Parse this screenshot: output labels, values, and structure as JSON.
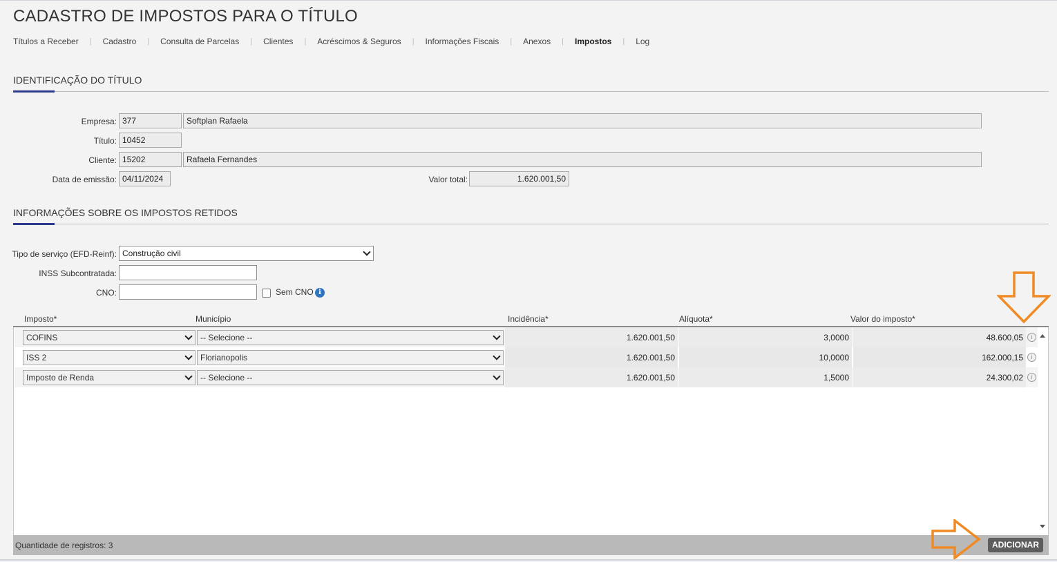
{
  "page": {
    "title": "CADASTRO DE IMPOSTOS PARA O TÍTULO"
  },
  "tabs": [
    {
      "label": "Títulos a Receber",
      "active": false
    },
    {
      "label": "Cadastro",
      "active": false
    },
    {
      "label": "Consulta de Parcelas",
      "active": false
    },
    {
      "label": "Clientes",
      "active": false
    },
    {
      "label": "Acréscimos & Seguros",
      "active": false
    },
    {
      "label": "Informações Fiscais",
      "active": false
    },
    {
      "label": "Anexos",
      "active": false
    },
    {
      "label": "Impostos",
      "active": true
    },
    {
      "label": "Log",
      "active": false
    }
  ],
  "identificacao": {
    "section_title": "IDENTIFICAÇÃO DO TÍTULO",
    "empresa_label": "Empresa:",
    "empresa_codigo": "377",
    "empresa_nome": "Softplan Rafaela",
    "titulo_label": "Título:",
    "titulo_valor": "10452",
    "cliente_label": "Cliente:",
    "cliente_codigo": "15202",
    "cliente_nome": "Rafaela Fernandes",
    "data_label": "Data de emissão:",
    "data_valor": "04/11/2024",
    "valor_total_label": "Valor total:",
    "valor_total": "1.620.001,50"
  },
  "impostos": {
    "section_title": "INFORMAÇÕES SOBRE OS IMPOSTOS RETIDOS",
    "tipo_servico_label": "Tipo de serviço (EFD-Reinf):",
    "tipo_servico_valor": "Construção civil",
    "inss_label": "INSS Subcontratada:",
    "inss_valor": "",
    "cno_label": "CNO:",
    "cno_valor": "",
    "sem_cno_label": "Sem CNO",
    "sem_cno_checked": false
  },
  "grid": {
    "columns": [
      "Imposto*",
      "Município",
      "Incidência*",
      "Alíquota*",
      "Valor do imposto*"
    ],
    "rows": [
      {
        "imposto": "COFINS",
        "municipio": "-- Selecione --",
        "incidencia": "1.620.001,50",
        "aliquota": "3,0000",
        "valor": "48.600,05"
      },
      {
        "imposto": "ISS 2",
        "municipio": "Florianopolis",
        "incidencia": "1.620.001,50",
        "aliquota": "10,0000",
        "valor": "162.000,15"
      },
      {
        "imposto": "Imposto de Renda",
        "municipio": "-- Selecione --",
        "incidencia": "1.620.001,50",
        "aliquota": "1,5000",
        "valor": "24.300,02"
      }
    ],
    "footer_count": "Quantidade de registros: 3",
    "add_button": "ADICIONAR"
  },
  "colors": {
    "accent": "#2b3a8c",
    "annotation_arrow": "#f08a24",
    "button": "#5d5d5d",
    "footer": "#b9b9b9"
  },
  "icons": [
    "info-icon",
    "row-info-icon",
    "chevron-down-icon",
    "scroll-up-icon",
    "scroll-down-icon",
    "arrow-down-annotation-icon",
    "arrow-right-annotation-icon"
  ]
}
